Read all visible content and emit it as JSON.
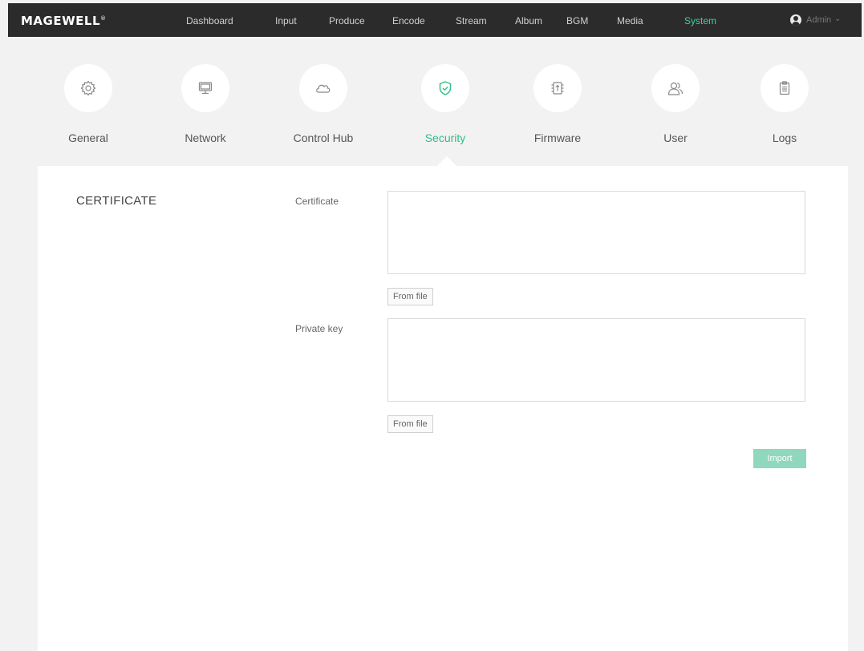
{
  "brand": {
    "name": "MAGEWELL",
    "mark": "®"
  },
  "nav": {
    "items": [
      {
        "label": "Dashboard"
      },
      {
        "label": "Input"
      },
      {
        "label": "Produce"
      },
      {
        "label": "Encode"
      },
      {
        "label": "Stream"
      },
      {
        "label": "Album"
      },
      {
        "label": "BGM"
      },
      {
        "label": "Media"
      },
      {
        "label": "System",
        "active": true
      }
    ],
    "user": {
      "name": "Admin",
      "chevron": "⌄"
    }
  },
  "tabs": [
    {
      "label": "General",
      "icon": "gear-icon"
    },
    {
      "label": "Network",
      "icon": "monitor-icon"
    },
    {
      "label": "Control Hub",
      "icon": "cloud-icon"
    },
    {
      "label": "Security",
      "icon": "shield-check-icon",
      "active": true
    },
    {
      "label": "Firmware",
      "icon": "chip-upload-icon"
    },
    {
      "label": "User",
      "icon": "users-icon"
    },
    {
      "label": "Logs",
      "icon": "clipboard-icon"
    }
  ],
  "certificate": {
    "section_title": "CERTIFICATE",
    "certificate_label": "Certificate",
    "certificate_value": "",
    "certificate_from_file": "From file",
    "private_key_label": "Private key",
    "private_key_value": "",
    "private_key_from_file": "From file",
    "import_label": "Import"
  },
  "colors": {
    "topbar": "#2b2b2b",
    "accent": "#2fbf87",
    "nav_active": "#3dd49a",
    "import_button": "#8fd8bd",
    "page_background": "#f2f2f2"
  }
}
